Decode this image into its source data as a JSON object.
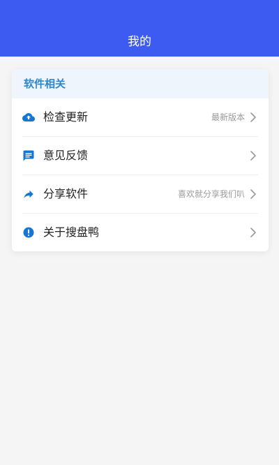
{
  "header": {
    "title": "我的"
  },
  "section": {
    "title": "软件相关",
    "items": [
      {
        "icon": "cloud-upload-icon",
        "label": "检查更新",
        "value": "最新版本"
      },
      {
        "icon": "feedback-icon",
        "label": "意见反馈",
        "value": ""
      },
      {
        "icon": "share-icon",
        "label": "分享软件",
        "value": "喜欢就分享我们叭"
      },
      {
        "icon": "info-icon",
        "label": "关于搜盘鸭",
        "value": ""
      }
    ]
  },
  "colors": {
    "header_bg": "#3d5af1",
    "section_title": "#2f86cc",
    "icon_blue": "#1677d2"
  }
}
